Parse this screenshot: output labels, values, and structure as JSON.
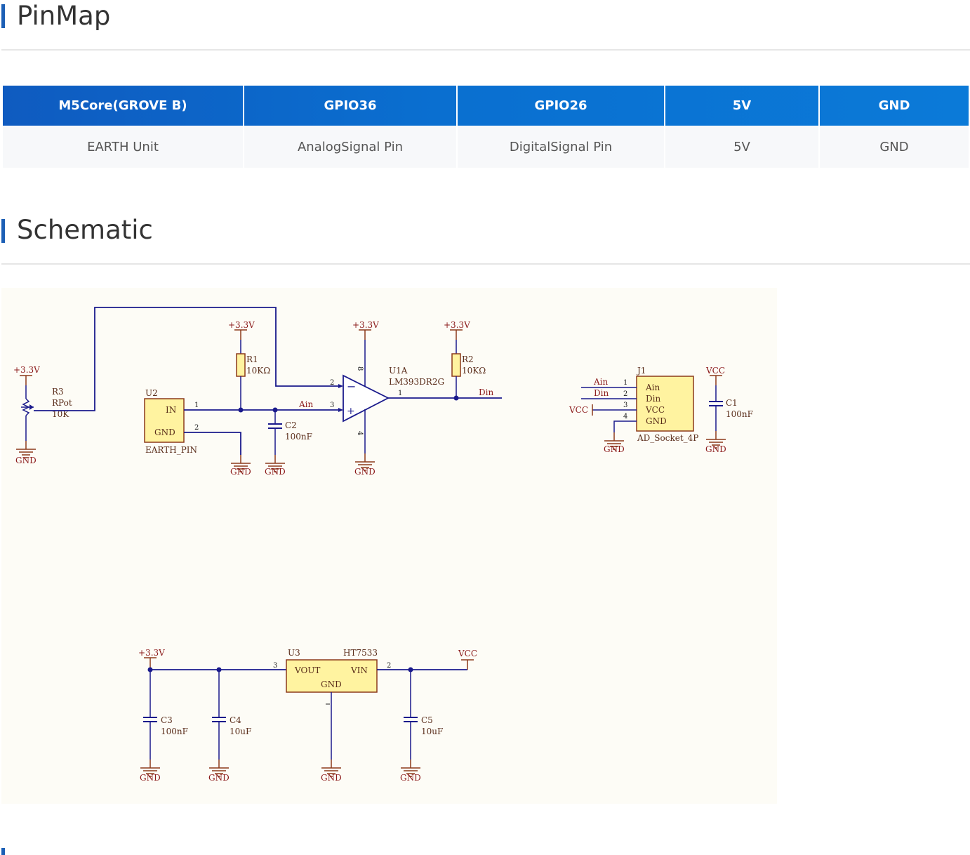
{
  "sections": {
    "pinmap_title": "PinMap",
    "schematic_title": "Schematic"
  },
  "pinmap": {
    "headers": [
      "M5Core(GROVE B)",
      "GPIO36",
      "GPIO26",
      "5V",
      "GND"
    ],
    "row": [
      "EARTH Unit",
      "AnalogSignal Pin",
      "DigitalSignal Pin",
      "5V",
      "GND"
    ]
  },
  "schematic": {
    "power": {
      "v33": "+3.3V",
      "vcc": "VCC",
      "gnd": "GND"
    },
    "r3": {
      "ref": "R3",
      "type": "RPot",
      "value": "10K"
    },
    "u2": {
      "ref": "U2",
      "name": "EARTH_PIN",
      "pin_in": "IN",
      "pin_gnd": "GND",
      "pin1": "1",
      "pin2": "2"
    },
    "r1": {
      "ref": "R1",
      "value": "10KΩ"
    },
    "r2": {
      "ref": "R2",
      "value": "10KΩ"
    },
    "c2": {
      "ref": "C2",
      "value": "100nF"
    },
    "u1a": {
      "ref": "U1A",
      "part": "LM393DR2G",
      "pin_inv": "2",
      "pin_noninv": "3",
      "pin_out": "1",
      "pin_vcc": "8",
      "pin_gnd": "4",
      "minus": "−",
      "plus": "+"
    },
    "nets": {
      "ain": "Ain",
      "din": "Din"
    },
    "j1": {
      "ref": "J1",
      "name": "AD_Socket_4P",
      "pins": [
        "Ain",
        "Din",
        "VCC",
        "GND"
      ],
      "nums": [
        "1",
        "2",
        "3",
        "4"
      ]
    },
    "c1": {
      "ref": "C1",
      "value": "100nF"
    },
    "u3": {
      "ref": "U3",
      "part": "HT7533",
      "vout": "VOUT",
      "vin": "VIN",
      "gnd": "GND",
      "pin_vout": "3",
      "pin_vin": "2"
    },
    "c3": {
      "ref": "C3",
      "value": "100nF"
    },
    "c4": {
      "ref": "C4",
      "value": "10uF"
    },
    "c5": {
      "ref": "C5",
      "value": "10uF"
    }
  },
  "colors": {
    "accent": "#1c5fb5",
    "table_header": "#0b6fd0",
    "wire": "#1a1a8c",
    "component_fill": "#fff3a0",
    "component_stroke": "#8b3a1a",
    "schematic_bg": "#fdfcf6"
  }
}
